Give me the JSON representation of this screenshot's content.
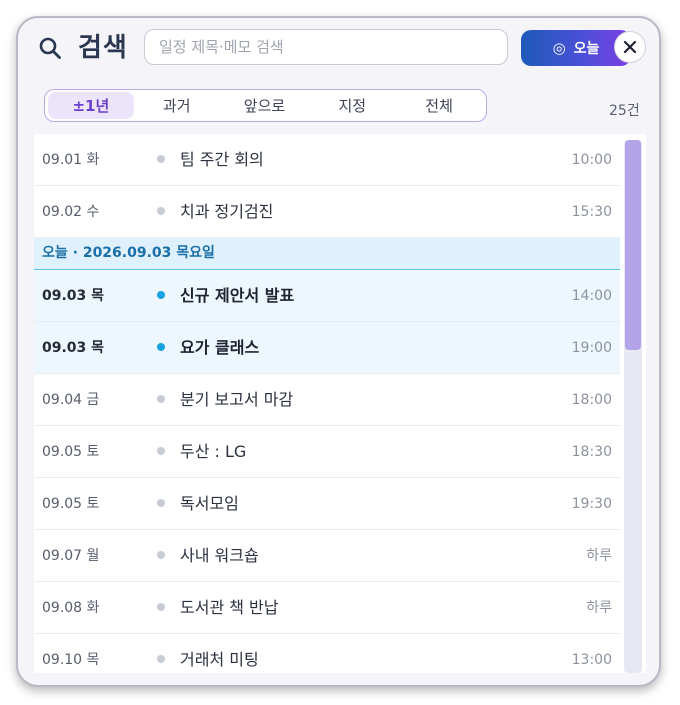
{
  "header": {
    "title": "검색",
    "search_placeholder": "일정 제목·메모 검색",
    "search_value": "",
    "today_button": "오늘",
    "close_label": "✕"
  },
  "tabs": [
    {
      "label": "±1년",
      "active": true
    },
    {
      "label": "과거",
      "active": false
    },
    {
      "label": "앞으로",
      "active": false
    },
    {
      "label": "지정",
      "active": false
    },
    {
      "label": "전체",
      "active": false
    }
  ],
  "count": "25건",
  "list": {
    "rows_before": [
      {
        "date": "09.01 화",
        "title": "팀 주간 회의",
        "time": "10:00"
      },
      {
        "date": "09.02 수",
        "title": "치과 정기검진",
        "time": "15:30"
      }
    ],
    "today_header": "오늘 · 2026.09.03 목요일",
    "today_rows": [
      {
        "date": "09.03 목",
        "title": "신규 제안서 발표",
        "time": "14:00"
      },
      {
        "date": "09.03 목",
        "title": "요가 클래스",
        "time": "19:00"
      }
    ],
    "rows_after": [
      {
        "date": "09.04 금",
        "title": "분기 보고서 마감",
        "time": "18:00"
      },
      {
        "date": "09.05 토",
        "title": "두산 : LG",
        "time": "18:30"
      },
      {
        "date": "09.05 토",
        "title": "독서모임",
        "time": "19:30"
      },
      {
        "date": "09.07 월",
        "title": "사내 워크숍",
        "time": "하루"
      },
      {
        "date": "09.08 화",
        "title": "도서관 책 반납",
        "time": "하루"
      },
      {
        "date": "09.10 목",
        "title": "거래처 미팅",
        "time": "13:00"
      }
    ]
  },
  "colors": {
    "accent": "#6a3fd0",
    "today_dot": "#1aa1e2",
    "scroll_thumb": "#b3a3e8"
  }
}
